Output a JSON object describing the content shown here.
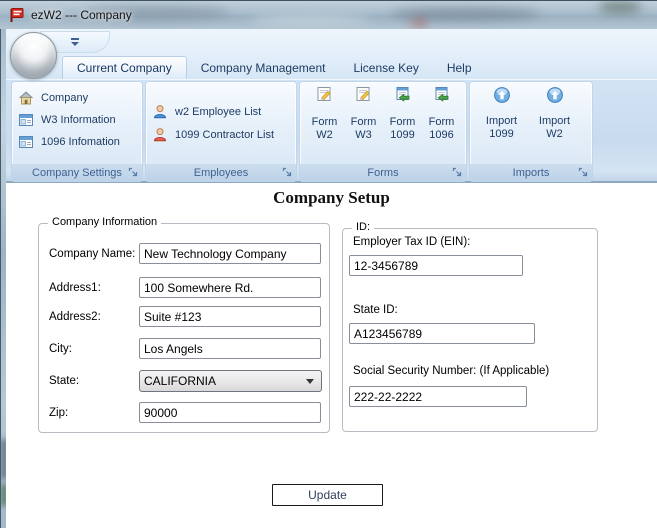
{
  "window": {
    "title": "ezW2 --- Company"
  },
  "colors": {
    "titlebar_glass": "#a9bccb",
    "ribbon_bg": "#cddfF1",
    "ribbon_text": "#1e3c64",
    "group_footer_text": "#3e618f",
    "app_icon_red": "#d42a1e",
    "selected_tab_bg": "#f7fbff"
  },
  "ribbon": {
    "tabs": [
      {
        "label": "Current Company",
        "selected": true
      },
      {
        "label": "Company Management",
        "selected": false
      },
      {
        "label": "License Key",
        "selected": false
      },
      {
        "label": "Help",
        "selected": false
      }
    ],
    "groups": [
      {
        "label": "Company Settings",
        "items": [
          {
            "label": "Company",
            "icon": "house-icon"
          },
          {
            "label": "W3 Information",
            "icon": "form-icon"
          },
          {
            "label": "1096 Infomation",
            "icon": "form-icon"
          }
        ]
      },
      {
        "label": "Employees",
        "items": [
          {
            "label": "w2 Employee List",
            "icon": "person-blue-icon"
          },
          {
            "label": "1099 Contractor List",
            "icon": "person-red-icon"
          }
        ]
      },
      {
        "label": "Forms",
        "buttons": [
          {
            "line1": "Form",
            "line2": "W2",
            "icon": "edit-document-icon"
          },
          {
            "line1": "Form",
            "line2": "W3",
            "icon": "edit-document-icon"
          },
          {
            "line1": "Form",
            "line2": "1099",
            "icon": "document-arrow-icon"
          },
          {
            "line1": "Form",
            "line2": "1096",
            "icon": "document-arrow-icon"
          }
        ]
      },
      {
        "label": "Imports",
        "buttons": [
          {
            "line1": "Import",
            "line2": "1099",
            "icon": "import-icon"
          },
          {
            "line1": "Import",
            "line2": "W2",
            "icon": "import-icon"
          }
        ]
      }
    ]
  },
  "main": {
    "heading": "Company Setup",
    "company_info": {
      "legend": "Company Information",
      "fields": [
        {
          "label": "Company Name:",
          "value": "New Technology Company"
        },
        {
          "label": "Address1:",
          "value": "100 Somewhere Rd."
        },
        {
          "label": "Address2:",
          "value": "Suite #123"
        },
        {
          "label": "City:",
          "value": "Los Angels"
        },
        {
          "label": "State:",
          "value": "CALIFORNIA"
        },
        {
          "label": "Zip:",
          "value": "90000"
        }
      ]
    },
    "id_info": {
      "legend": "ID:",
      "fields": [
        {
          "label": "Employer Tax ID (EIN):",
          "value": "12-3456789"
        },
        {
          "label": "State ID:",
          "value": "A123456789"
        },
        {
          "label": "Social Security Number: (If Applicable)",
          "value": "222-22-2222"
        }
      ]
    },
    "update_button": "Update"
  }
}
